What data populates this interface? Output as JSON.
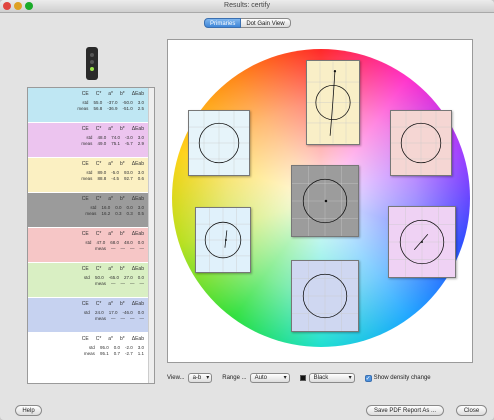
{
  "window": {
    "title": "Results: certify"
  },
  "tabs": [
    {
      "label": "Primaries",
      "active": true
    },
    {
      "label": "Dot Gain View",
      "active": false
    }
  ],
  "table_header": {
    "ce": "CE",
    "c": "C*",
    "a": "a*",
    "b": "b*",
    "dab": "ΔEab"
  },
  "patches": [
    {
      "color": "#bfe7f3",
      "rows": [
        {
          "k": "std",
          "v": [
            "55.0",
            "-37.0",
            "-50.0",
            "3.0"
          ]
        },
        {
          "k": "meas",
          "v": [
            "56.8",
            "-36.9",
            "-51.0",
            "2.5"
          ]
        }
      ]
    },
    {
      "color": "#ecc4ef",
      "rows": [
        {
          "k": "std",
          "v": [
            "48.0",
            "74.0",
            "-3.0",
            "3.0"
          ]
        },
        {
          "k": "meas",
          "v": [
            "49.0",
            "75.1",
            "-5.7",
            "2.9"
          ]
        }
      ]
    },
    {
      "color": "#fbf0c2",
      "rows": [
        {
          "k": "std",
          "v": [
            "89.0",
            "-5.0",
            "93.0",
            "3.0"
          ]
        },
        {
          "k": "meas",
          "v": [
            "88.8",
            "-4.5",
            "92.7",
            "0.6"
          ]
        }
      ]
    },
    {
      "color": "#9b9b9b",
      "rows": [
        {
          "k": "std",
          "v": [
            "16.0",
            "0.0",
            "0.0",
            "3.0"
          ]
        },
        {
          "k": "meas",
          "v": [
            "16.2",
            "0.3",
            "0.3",
            "0.5"
          ]
        }
      ]
    },
    {
      "color": "#f6c6c6",
      "rows": [
        {
          "k": "std",
          "v": [
            "47.0",
            "68.0",
            "48.0",
            "0.0"
          ]
        },
        {
          "k": "meas",
          "v": [
            "—",
            "—",
            "—",
            "—"
          ]
        }
      ]
    },
    {
      "color": "#d9efc3",
      "rows": [
        {
          "k": "std",
          "v": [
            "50.0",
            "-65.0",
            "27.0",
            "0.0"
          ]
        },
        {
          "k": "meas",
          "v": [
            "—",
            "—",
            "—",
            "—"
          ]
        }
      ]
    },
    {
      "color": "#c6d2f0",
      "rows": [
        {
          "k": "std",
          "v": [
            "24.0",
            "17.0",
            "-46.0",
            "0.0"
          ]
        },
        {
          "k": "meas",
          "v": [
            "—",
            "—",
            "—",
            "—"
          ]
        }
      ]
    },
    {
      "color": "#ffffff",
      "rows": [
        {
          "k": "std",
          "v": [
            "95.0",
            "0.0",
            "-2.0",
            "3.0"
          ]
        },
        {
          "k": "meas",
          "v": [
            "95.1",
            "0.7",
            "-2.7",
            "1.1"
          ]
        }
      ]
    }
  ],
  "controls": {
    "view_label": "View...",
    "view_value": "a-b",
    "range_label": "Range ...",
    "range_value": "Auto",
    "channel_value": "Black",
    "density_label": "Show density change"
  },
  "buttons": {
    "help": "Help",
    "save": "Save PDF Report As ...",
    "close": "Close"
  },
  "subplots": [
    {
      "id": "yellow",
      "color": "#f9efc7"
    },
    {
      "id": "cyan",
      "color": "#e6f4fa"
    },
    {
      "id": "red",
      "color": "#f5d6d3"
    },
    {
      "id": "black",
      "color": "#9c9c9c"
    },
    {
      "id": "blue-light",
      "color": "#e0f1fb"
    },
    {
      "id": "magenta",
      "color": "#efd2f4"
    },
    {
      "id": "blue",
      "color": "#cfd7f1"
    }
  ]
}
